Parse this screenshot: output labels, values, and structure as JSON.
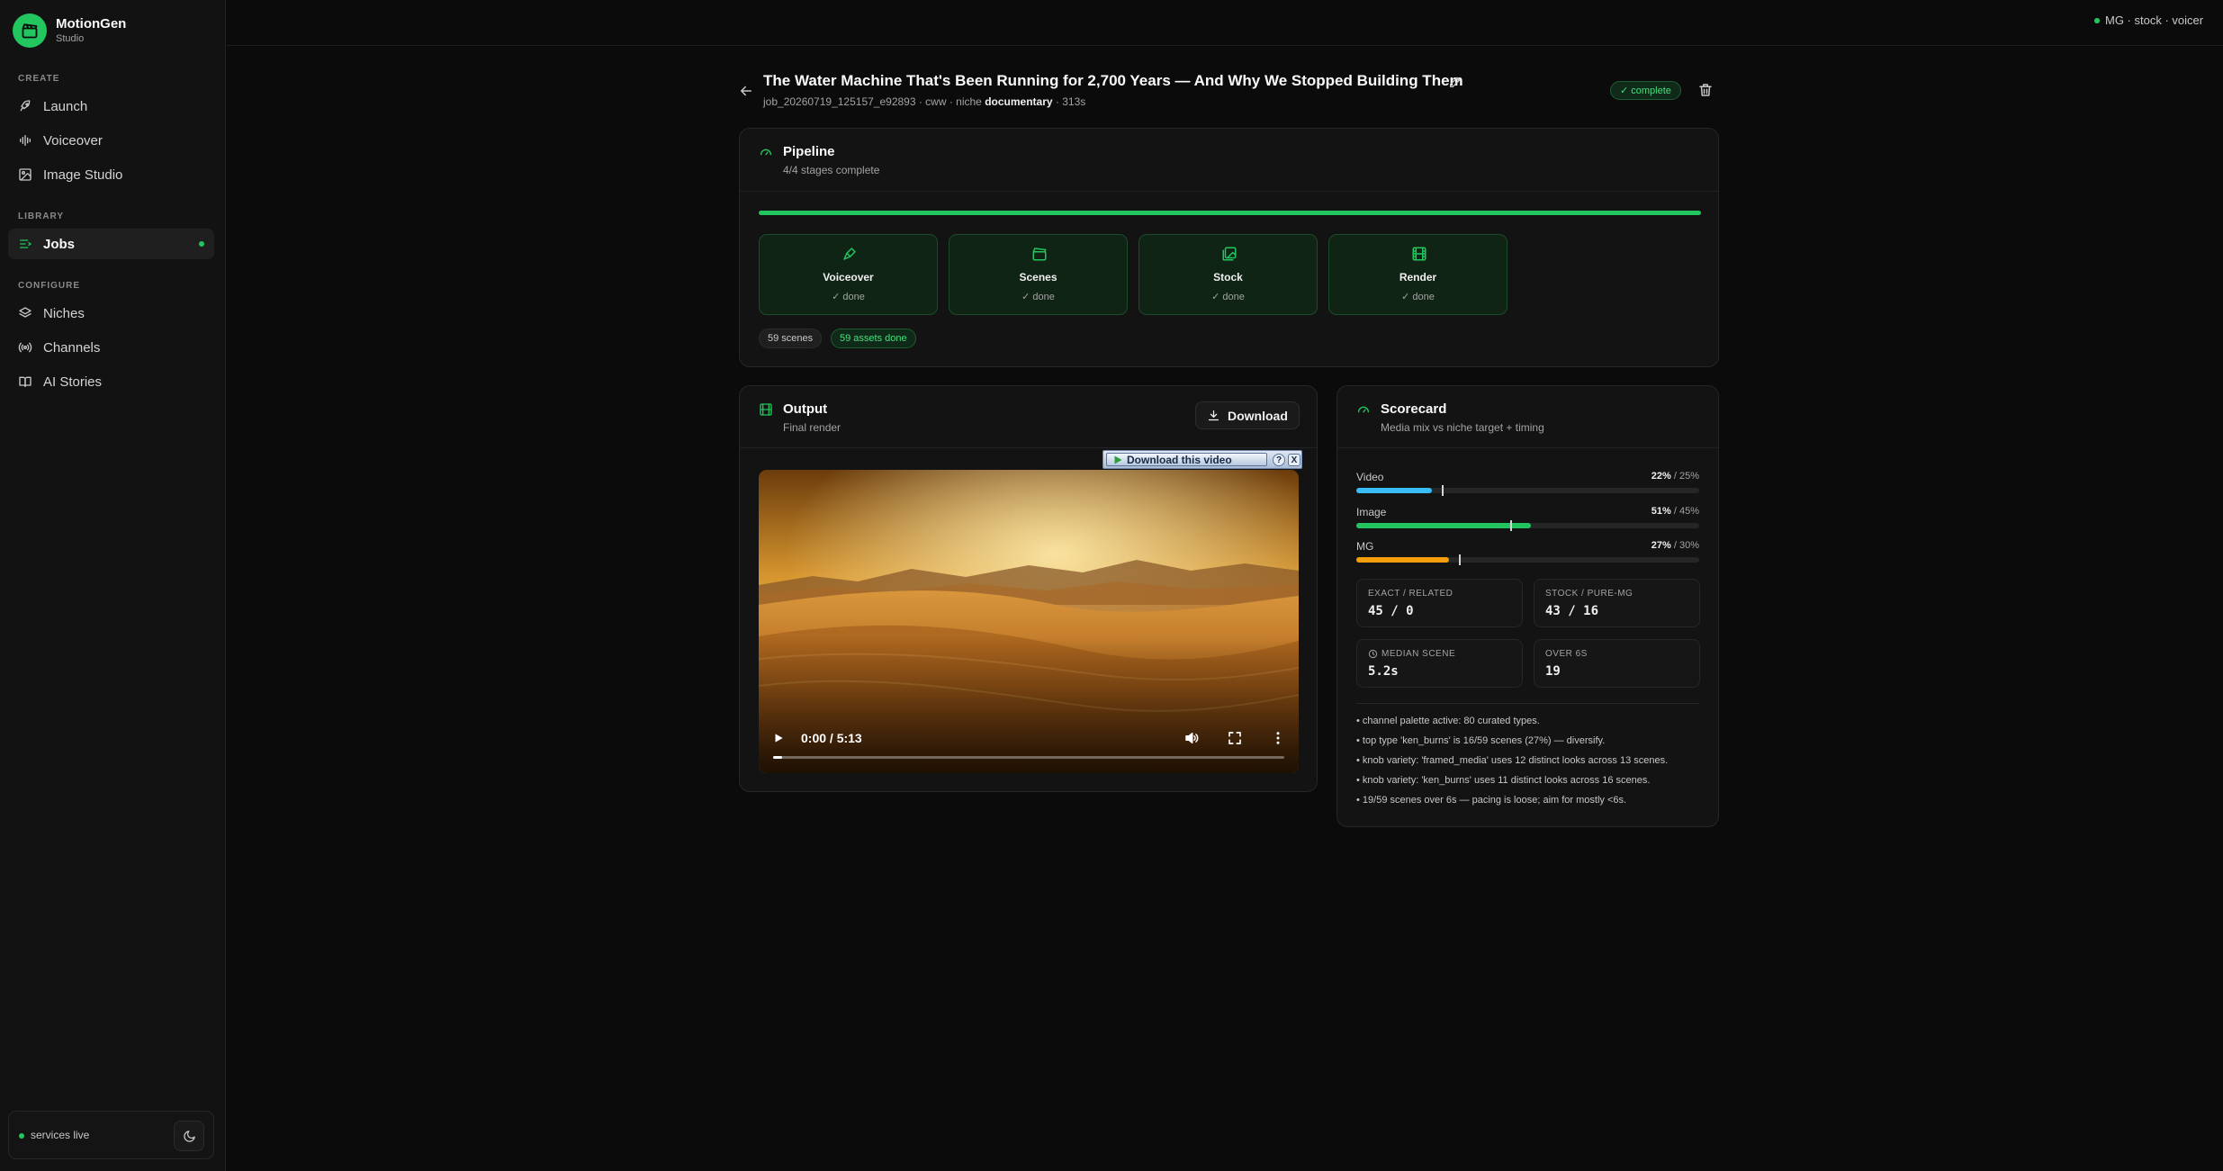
{
  "app": {
    "name": "MotionGen",
    "subtitle": "Studio"
  },
  "sidebar": {
    "sections": [
      {
        "label": "CREATE"
      },
      {
        "label": "LIBRARY"
      },
      {
        "label": "CONFIGURE"
      }
    ],
    "items": [
      {
        "label": "Launch",
        "icon": "rocket-icon"
      },
      {
        "label": "Voiceover",
        "icon": "audio-wave-icon"
      },
      {
        "label": "Image Studio",
        "icon": "image-icon"
      },
      {
        "label": "Jobs",
        "icon": "list-icon",
        "active": true
      },
      {
        "label": "Niches",
        "icon": "layers-icon"
      },
      {
        "label": "Channels",
        "icon": "broadcast-icon"
      },
      {
        "label": "AI Stories",
        "icon": "book-icon"
      }
    ],
    "footer": {
      "status": "services live",
      "theme_icon": "moon-icon"
    }
  },
  "topbar": {
    "status": "MG · stock · voicer"
  },
  "job": {
    "title": "The Water Machine That's Been Running for 2,700 Years — And Why We Stopped Building Them",
    "meta_prefix": "job_20260719_125157_e92893 · cww · niche",
    "meta_niche": "documentary",
    "meta_suffix": "· 313s",
    "status": "✓ complete"
  },
  "pipeline": {
    "title": "Pipeline",
    "subtitle": "4/4 stages complete",
    "progress": 1.0,
    "stages": [
      {
        "name": "Voiceover",
        "status": "✓ done",
        "icon": "microphone-icon"
      },
      {
        "name": "Scenes",
        "status": "✓ done",
        "icon": "clapperboard-icon"
      },
      {
        "name": "Stock",
        "status": "✓ done",
        "icon": "images-icon"
      },
      {
        "name": "Render",
        "status": "✓ done",
        "icon": "film-icon"
      }
    ],
    "chips": {
      "scenes": "59 scenes",
      "assets": "59 assets done"
    }
  },
  "output": {
    "title": "Output",
    "subtitle": "Final render",
    "download_label": "Download",
    "popup_label": "Download this video",
    "popup_help": "?",
    "popup_close": "X",
    "video": {
      "time": "0:00 / 5:13",
      "progress": 0.0
    }
  },
  "scorecard": {
    "title": "Scorecard",
    "subtitle": "Media mix vs niche target + timing",
    "metrics": [
      {
        "label": "Video",
        "actual": "22%",
        "target": "/ 25%",
        "actual_frac": 0.22,
        "target_frac": 0.25,
        "color": "#38bdf8"
      },
      {
        "label": "Image",
        "actual": "51%",
        "target": "/ 45%",
        "actual_frac": 0.51,
        "target_frac": 0.45,
        "color": "#22c55e"
      },
      {
        "label": "MG",
        "actual": "27%",
        "target": "/ 30%",
        "actual_frac": 0.27,
        "target_frac": 0.3,
        "color": "#f59e0b"
      }
    ],
    "stats": [
      {
        "label": "EXACT / RELATED",
        "value": "45 / 0"
      },
      {
        "label": "STOCK / PURE-MG",
        "value": "43 / 16"
      },
      {
        "label": "MEDIAN SCENE",
        "value": "5.2s"
      },
      {
        "label": "OVER 6S",
        "value": "19"
      }
    ],
    "notes": [
      "• channel palette active: 80 curated types.",
      "• top type 'ken_burns' is 16/59 scenes (27%) — diversify.",
      "• knob variety: 'framed_media' uses 12 distinct looks across 13 scenes.",
      "• knob variety: 'ken_burns' uses 11 distinct looks across 16 scenes.",
      "• 19/59 scenes over 6s — pacing is loose; aim for mostly <6s."
    ]
  }
}
